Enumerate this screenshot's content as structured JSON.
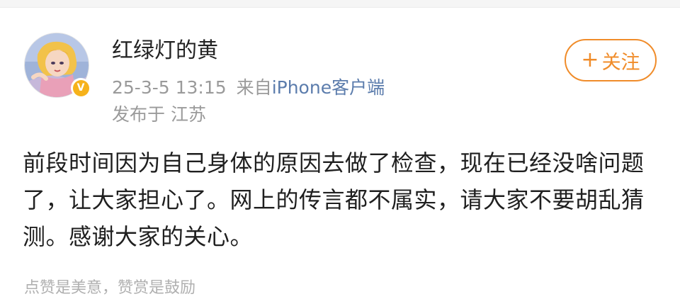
{
  "post": {
    "author": {
      "name": "红绿灯的黄",
      "verified_badge": "V",
      "avatar_icon": "cartoon-girl-avatar"
    },
    "meta": {
      "timestamp": "25-3-5 13:15",
      "source_prefix": "来自",
      "source_device": "iPhone客户端",
      "location": "发布于 江苏"
    },
    "follow_button": {
      "plus": "+",
      "label": "关注"
    },
    "content": "前段时间因为自己身体的原因去做了检查，现在已经没啥问题了，让大家担心了。网上的传言都不属实，请大家不要胡乱猜测。感谢大家的关心。",
    "reward_hint": "点赞是美意，赞赏是鼓励"
  },
  "colors": {
    "accent": "#f08c2a",
    "link": "#5b7cac",
    "muted": "#9a9a9a",
    "badge": "#f6b21b"
  }
}
